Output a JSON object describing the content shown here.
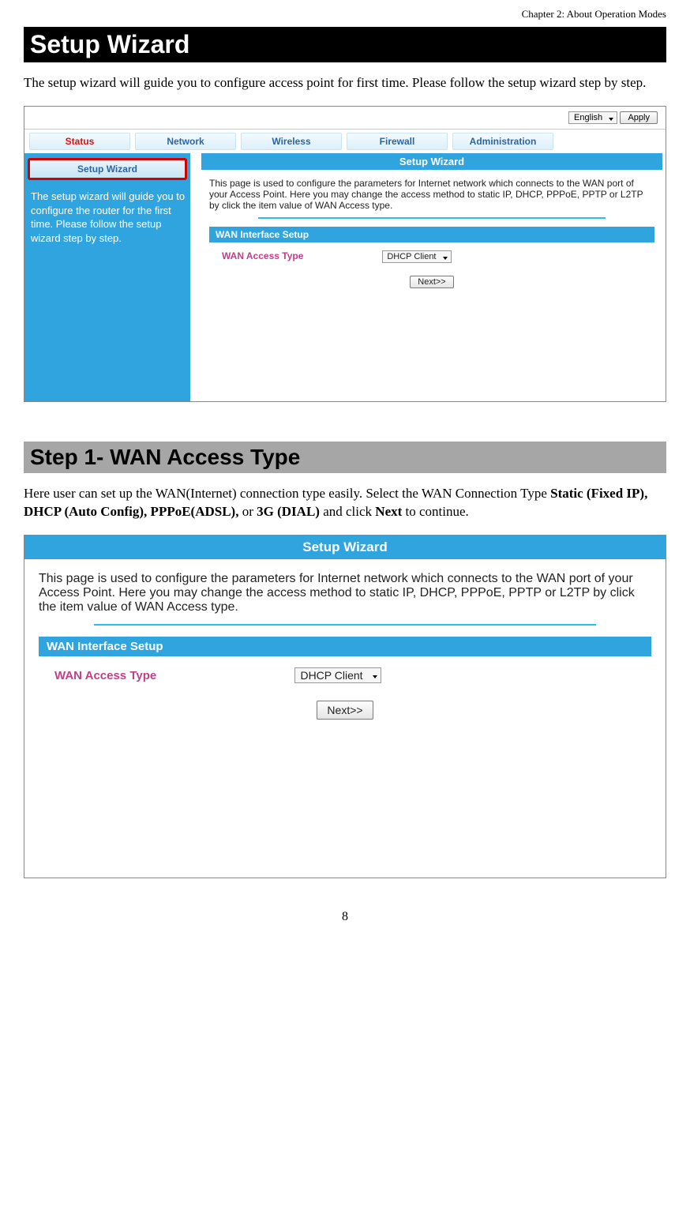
{
  "chapterHeader": "Chapter 2: About Operation Modes",
  "h1": "Setup Wizard",
  "intro": "The setup wizard will guide you to configure access point for first time. Please follow the setup wizard step by step.",
  "shot1": {
    "language": "English",
    "applyBtn": "Apply",
    "tabs": {
      "status": "Status",
      "network": "Network",
      "wireless": "Wireless",
      "firewall": "Firewall",
      "admin": "Administration"
    },
    "sideBtn": "Setup Wizard",
    "sideHelp": "The setup wizard will guide you to configure the router for the first time. Please follow the setup wizard step by step.",
    "panelTitle": "Setup Wizard",
    "panelDesc": "This page is used to configure the parameters for Internet network which connects to the WAN port of your Access Point. Here you may change the access method to static IP, DHCP, PPPoE, PPTP or L2TP by click the item value of WAN Access type.",
    "wanSetupBar": "WAN Interface Setup",
    "wanAccessLabel": "WAN Access Type",
    "wanAccessValue": "DHCP Client",
    "nextBtn": "Next>>"
  },
  "h2": "Step 1- WAN Access Type",
  "step1Text": {
    "pre": "Here user can set up the WAN(Internet) connection type easily. Select the WAN Connection Type ",
    "b1": "Static (Fixed IP), DHCP (Auto Config), PPPoE(ADSL),",
    "mid1": " or ",
    "b2": "3G (DIAL)",
    "mid2": " and click ",
    "b3": "Next",
    "post": " to continue."
  },
  "shot2": {
    "panelTitle": "Setup Wizard",
    "panelDesc": "This page is used to configure the parameters for Internet network which connects to the WAN port of your Access Point. Here you may change the access method to static IP, DHCP, PPPoE, PPTP or L2TP by click the item value of WAN Access type.",
    "wanSetupBar": "WAN Interface Setup",
    "wanAccessLabel": "WAN Access Type",
    "wanAccessValue": "DHCP Client",
    "nextBtn": "Next>>"
  },
  "pageNum": "8"
}
